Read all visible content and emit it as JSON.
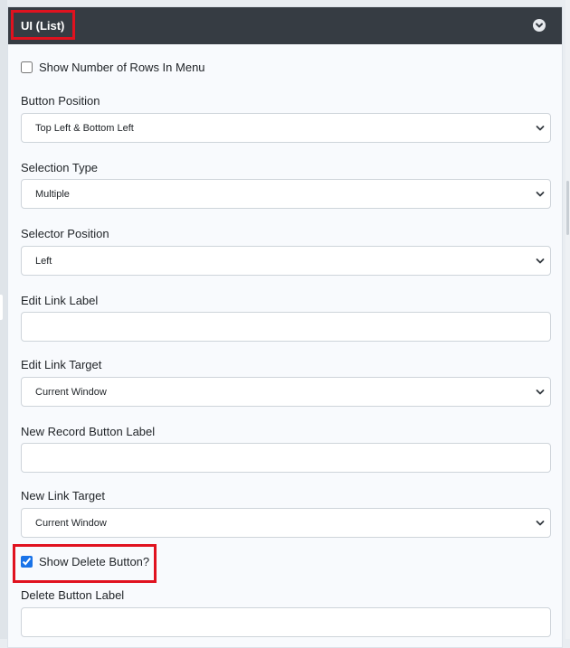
{
  "panel": {
    "title": "UI (List)"
  },
  "show_rows_checkbox": {
    "label": "Show Number of Rows In Menu",
    "checked": false
  },
  "fields": {
    "button_position": {
      "label": "Button Position",
      "value": "Top Left & Bottom Left"
    },
    "selection_type": {
      "label": "Selection Type",
      "value": "Multiple"
    },
    "selector_position": {
      "label": "Selector Position",
      "value": "Left"
    },
    "edit_link_label": {
      "label": "Edit Link Label",
      "value": ""
    },
    "edit_link_target": {
      "label": "Edit Link Target",
      "value": "Current Window"
    },
    "new_record_button_label": {
      "label": "New Record Button Label",
      "value": ""
    },
    "new_link_target": {
      "label": "New Link Target",
      "value": "Current Window"
    },
    "delete_button_label": {
      "label": "Delete Button Label",
      "value": ""
    }
  },
  "show_delete_checkbox": {
    "label": "Show Delete Button?",
    "checked": true
  },
  "colors": {
    "header_bg": "#363c43",
    "panel_bg": "#f8fafd",
    "highlight": "#e0121f",
    "checkbox_accent": "#1a73e8"
  }
}
